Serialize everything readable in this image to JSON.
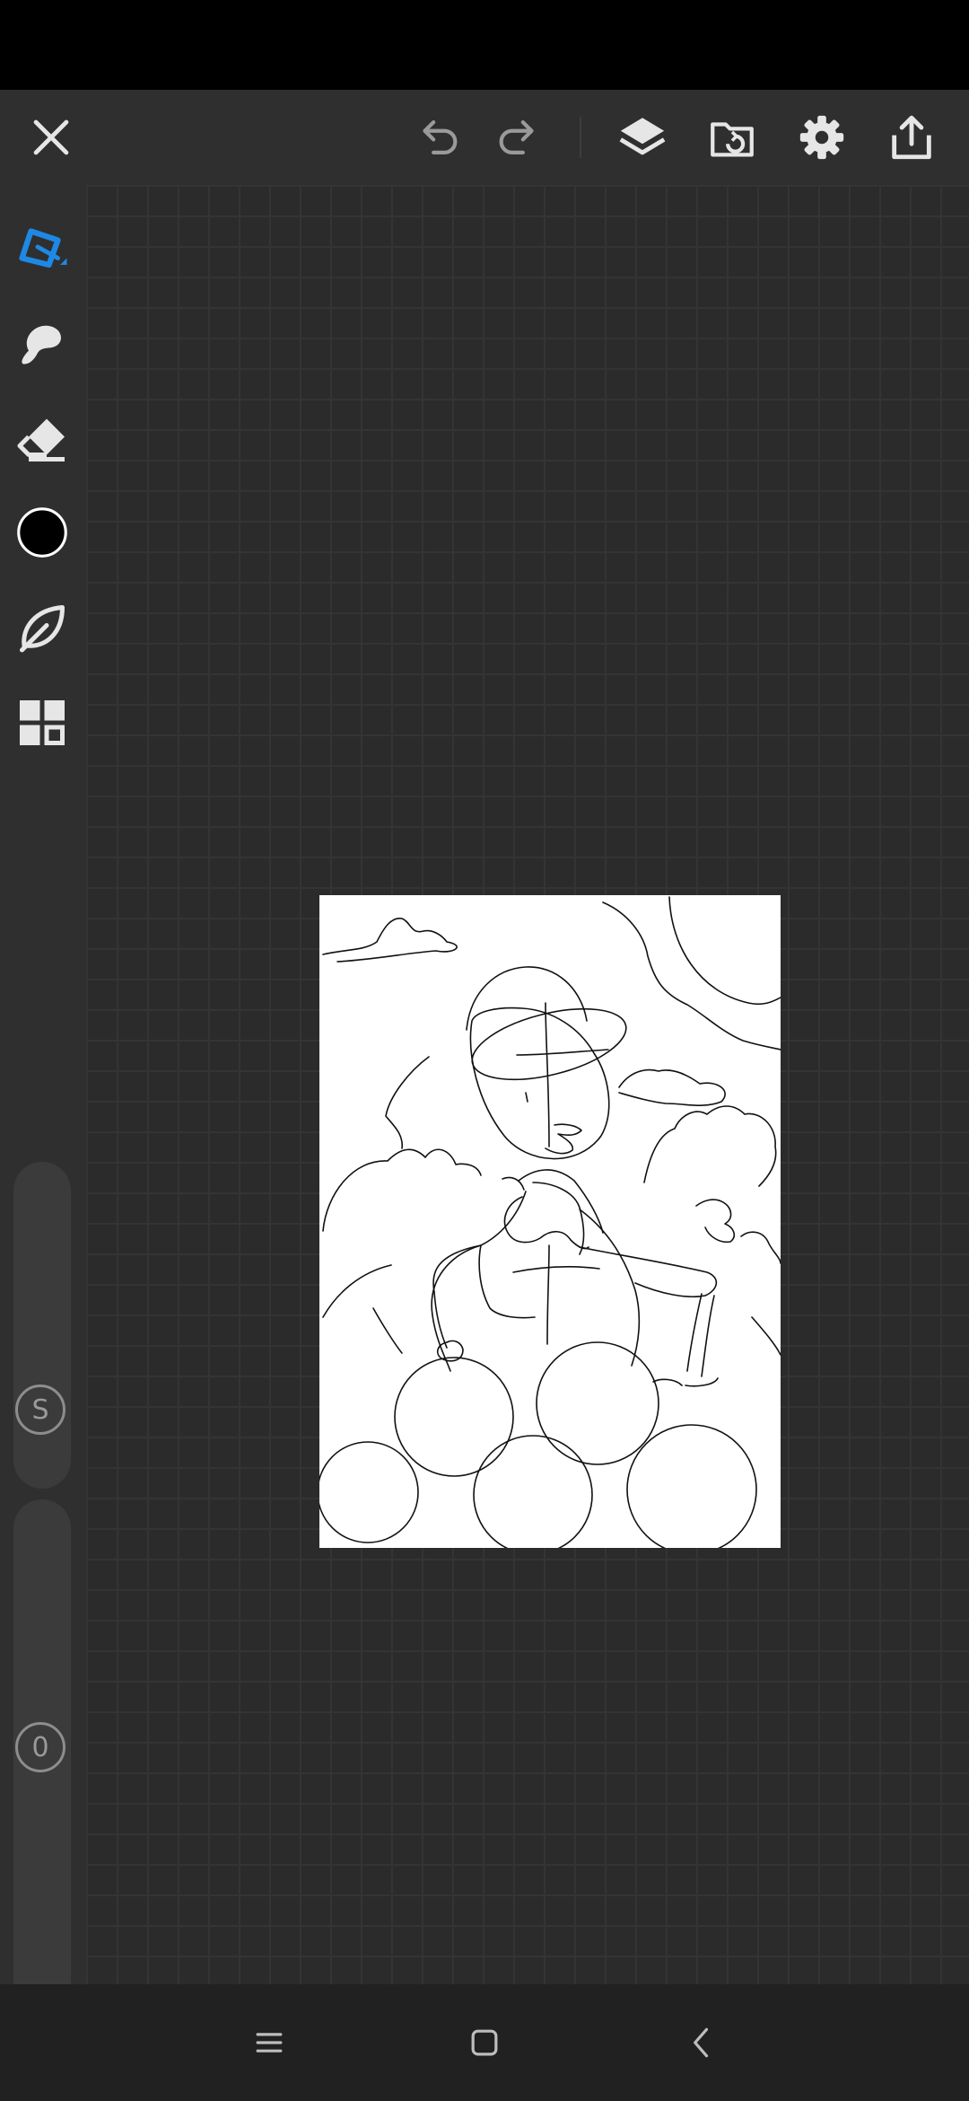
{
  "colors": {
    "background": "#2b2b2b",
    "toolbar": "#2f2f2f",
    "accent": "#1e88e5",
    "icon": "#e6e6e6",
    "status_bar": "#000000",
    "nav_bar": "#212121",
    "paper": "#ffffff",
    "current_color": "#000000"
  },
  "top_toolbar": {
    "icons": [
      "close-icon",
      "undo-icon",
      "redo-icon",
      "layers-icon",
      "gallery-import-icon",
      "gear-icon",
      "share-icon"
    ]
  },
  "left_toolbar": {
    "tools": [
      "pen-tool-icon",
      "smudge-icon",
      "eraser-icon",
      "color-swatch",
      "lasso-leaf-icon",
      "grid-menu-icon"
    ],
    "selected_tool": "pen-tool-icon",
    "size_slider_label": "S",
    "opacity_slider_label": "0"
  },
  "nav_bar": {
    "icons": [
      "recent-apps-icon",
      "home-icon",
      "back-icon"
    ]
  }
}
